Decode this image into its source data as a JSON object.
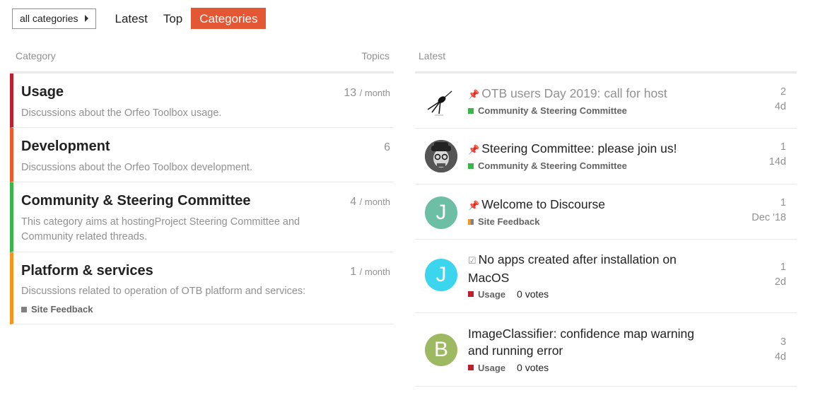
{
  "nav": {
    "category_dropdown": "all categories",
    "tabs": [
      "Latest",
      "Top",
      "Categories"
    ]
  },
  "categories_table": {
    "header_category": "Category",
    "header_topics": "Topics",
    "rows": [
      {
        "name": "Usage",
        "description": "Discussions about the Orfeo Toolbox usage.",
        "count": "13",
        "per": "/ month",
        "color": "#bf1e2e"
      },
      {
        "name": "Development",
        "description": "Discussions about the Orfeo Toolbox development.",
        "count": "6",
        "per": "",
        "color": "#f1592a"
      },
      {
        "name": "Community & Steering Committee",
        "description": "This category aims at hostingProject Steering Committee and Community related threads.",
        "count": "4",
        "per": "/ month",
        "color": "#3ab54a"
      },
      {
        "name": "Platform & services",
        "description": "Discussions related to operation of OTB platform and services:",
        "count": "1",
        "per": "/ month",
        "color": "#f7941d",
        "subcategory": "Site Feedback",
        "subcategory_color": "#808281"
      }
    ]
  },
  "latest": {
    "header": "Latest",
    "topics": [
      {
        "title": "OTB users Day 2019: call for host",
        "icon": "pin-icon",
        "category": "Community & Steering Committee",
        "category_color": "#3ab54a",
        "replies": "2",
        "age": "4d",
        "avatar_kind": "satellite"
      },
      {
        "title": "Steering Committee: please join us!",
        "icon": "pin-icon",
        "category": "Community & Steering Committee",
        "category_color": "#3ab54a",
        "replies": "1",
        "age": "14d",
        "avatar_kind": "photo"
      },
      {
        "title": "Welcome to Discourse",
        "icon": "pin-icon",
        "category": "Site Feedback",
        "category_color": "#808281",
        "parent_color": "#f7941d",
        "replies": "1",
        "age": "Dec '18",
        "avatar_letter": "J",
        "avatar_color": "#6cbfa4"
      },
      {
        "title": "No apps created after installation on MacOS",
        "icon": "checkbox-icon",
        "category": "Usage",
        "category_color": "#bf1e2e",
        "votes": "0 votes",
        "replies": "1",
        "age": "2d",
        "avatar_letter": "J",
        "avatar_color": "#3bd5ee"
      },
      {
        "title": "ImageClassifier: confidence map warning and running error",
        "category": "Usage",
        "category_color": "#bf1e2e",
        "votes": "0 votes",
        "replies": "3",
        "age": "4d",
        "avatar_letter": "B",
        "avatar_color": "#9db961"
      }
    ]
  }
}
